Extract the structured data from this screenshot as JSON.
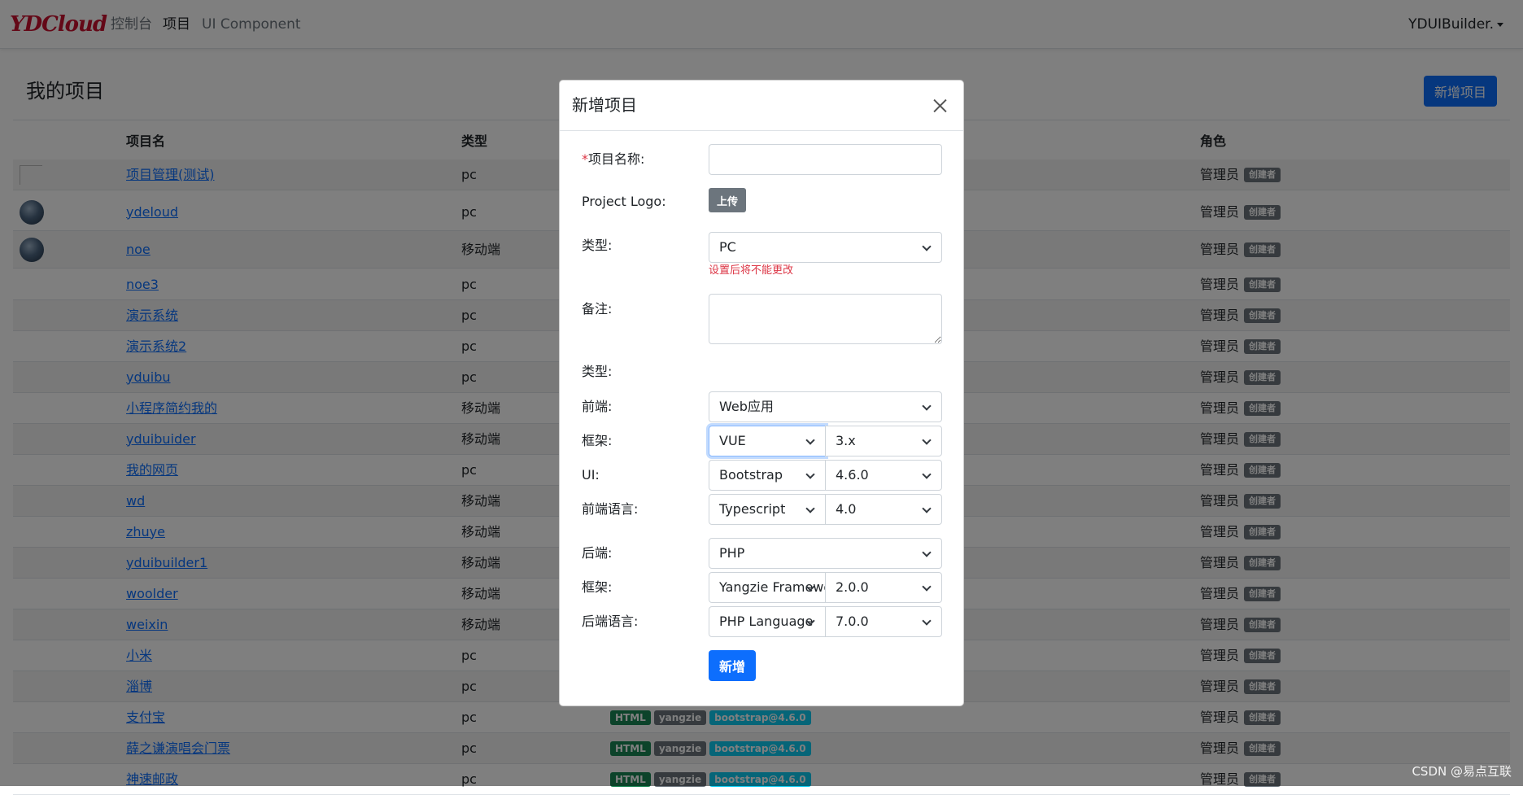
{
  "navbar": {
    "brand": "YDCloud",
    "links": [
      "控制台",
      "项目",
      "UI Component"
    ],
    "active_link": "项目",
    "user": "YDUIBuilder."
  },
  "page": {
    "title": "我的项目",
    "add_button": "新增项目"
  },
  "table": {
    "headers": [
      "项目名",
      "类型",
      "角色"
    ],
    "rows": [
      {
        "name": "项目管理(测试)",
        "type": "pc",
        "role": "管理员",
        "badge": "创建者",
        "avatar": "broken"
      },
      {
        "name": "ydeloud",
        "type": "pc",
        "role": "管理员",
        "badge": "创建者",
        "avatar": "image"
      },
      {
        "name": "noe",
        "type": "移动端",
        "role": "管理员",
        "badge": "创建者",
        "avatar": "image"
      },
      {
        "name": "noe3",
        "type": "pc",
        "role": "管理员",
        "badge": "创建者"
      },
      {
        "name": "演示系统",
        "type": "pc",
        "role": "管理员",
        "badge": "创建者"
      },
      {
        "name": "演示系统2",
        "type": "pc",
        "role": "管理员",
        "badge": "创建者"
      },
      {
        "name": "yduibu",
        "type": "pc",
        "role": "管理员",
        "badge": "创建者"
      },
      {
        "name": "小程序简约我的",
        "type": "移动端",
        "role": "管理员",
        "badge": "创建者"
      },
      {
        "name": "yduibuider",
        "type": "移动端",
        "role": "管理员",
        "badge": "创建者"
      },
      {
        "name": "我的网页",
        "type": "pc",
        "role": "管理员",
        "badge": "创建者"
      },
      {
        "name": "wd",
        "type": "移动端",
        "role": "管理员",
        "badge": "创建者"
      },
      {
        "name": "zhuye",
        "type": "移动端",
        "role": "管理员",
        "badge": "创建者"
      },
      {
        "name": "yduibuilder1",
        "type": "移动端",
        "role": "管理员",
        "badge": "创建者"
      },
      {
        "name": "woolder",
        "type": "移动端",
        "role": "管理员",
        "badge": "创建者"
      },
      {
        "name": "weixin",
        "type": "移动端",
        "role": "管理员",
        "badge": "创建者"
      },
      {
        "name": "小米",
        "type": "pc",
        "role": "管理员",
        "badge": "创建者"
      },
      {
        "name": "淄博",
        "type": "pc",
        "role": "管理员",
        "badge": "创建者"
      },
      {
        "name": "支付宝",
        "type": "pc",
        "role": "管理员",
        "badge": "创建者",
        "tags": [
          "HTML",
          "yangzie",
          "bootstrap@4.6.0"
        ]
      },
      {
        "name": "薛之谦演唱会门票",
        "type": "pc",
        "role": "管理员",
        "badge": "创建者",
        "tags": [
          "HTML",
          "yangzie",
          "bootstrap@4.6.0"
        ]
      },
      {
        "name": "神速邮政",
        "type": "pc",
        "role": "管理员",
        "badge": "创建者",
        "tags": [
          "HTML",
          "yangzie",
          "bootstrap@4.6.0"
        ]
      }
    ]
  },
  "modal": {
    "title": "新增项目",
    "name_label": "项目名称:",
    "name_required_mark": "*",
    "name_value": "",
    "logo_label": "Project Logo:",
    "upload_button": "上传",
    "type_label": "类型:",
    "type_value": "PC",
    "type_help": "设置后将不能更改",
    "remark_label": "备注:",
    "remark_value": "",
    "stack_label": "类型:",
    "frontend_label": "前端:",
    "frontend_value": "Web应用",
    "fe_framework_label": "框架:",
    "fe_framework_value": "VUE",
    "fe_framework_version": "3.x",
    "ui_label": "UI:",
    "ui_value": "Bootstrap",
    "ui_version": "4.6.0",
    "fe_lang_label": "前端语言:",
    "fe_lang_value": "Typescript",
    "fe_lang_version": "4.0",
    "backend_label": "后端:",
    "backend_value": "PHP",
    "be_framework_label": "框架:",
    "be_framework_value": "Yangzie Framework",
    "be_framework_version": "2.0.0",
    "be_lang_label": "后端语言:",
    "be_lang_value": "PHP Language",
    "be_lang_version": "7.0.0",
    "submit_button": "新增"
  },
  "watermark": "CSDN @易点互联"
}
